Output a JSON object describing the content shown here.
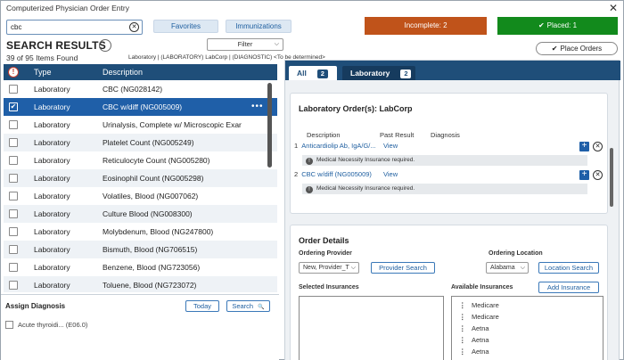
{
  "window": {
    "title": "Computerized Physician Order Entry",
    "close_glyph": "✕"
  },
  "search": {
    "value": "cbc",
    "clear_glyph": "✕"
  },
  "chips": {
    "favorites": "Favorites",
    "immunizations": "Immunizations"
  },
  "status": {
    "incomplete": "Incomplete: 2",
    "placed": "Placed: 1",
    "incomplete_color": "#c0531a",
    "placed_color": "#128a1c"
  },
  "place_orders": {
    "check": "✔",
    "label": "Place Orders"
  },
  "results": {
    "title": "SEARCH RESULTS",
    "count": "39 of 95 Items Found",
    "filter_label": "Filter",
    "breadcrumb": "Laboratory | (LABORATORY) LabCorp | (DIAGNOSTIC) <To be determined>"
  },
  "table": {
    "headers": {
      "alert": "!",
      "type": "Type",
      "description": "Description"
    },
    "rows": [
      {
        "type": "Laboratory",
        "description": "CBC (NG028142)"
      },
      {
        "type": "Laboratory",
        "description": "CBC w/diff (NG005009)",
        "selected": true,
        "check": "✔",
        "dots": "•••"
      },
      {
        "type": "Laboratory",
        "description": "Urinalysis, Complete w/ Microscopic Exar"
      },
      {
        "type": "Laboratory",
        "description": "Platelet Count (NG005249)"
      },
      {
        "type": "Laboratory",
        "description": "Reticulocyte Count (NG005280)"
      },
      {
        "type": "Laboratory",
        "description": "Eosinophil Count (NG005298)"
      },
      {
        "type": "Laboratory",
        "description": "Volatiles, Blood (NG007062)"
      },
      {
        "type": "Laboratory",
        "description": "Culture Blood (NG008300)"
      },
      {
        "type": "Laboratory",
        "description": "Molybdenum, Blood (NG247800)"
      },
      {
        "type": "Laboratory",
        "description": "Bismuth, Blood (NG706515)"
      },
      {
        "type": "Laboratory",
        "description": "Benzene, Blood (NG723056)"
      },
      {
        "type": "Laboratory",
        "description": "Toluene, Blood (NG723072)"
      }
    ]
  },
  "assign": {
    "title": "Assign Diagnosis",
    "today": "Today",
    "search": "Search",
    "search_icon": "🔍",
    "diagnosis": "Acute thyroidi... (E06.0)"
  },
  "tabs": {
    "all": {
      "label": "All",
      "count": "2"
    },
    "lab": {
      "label": "Laboratory",
      "count": "2"
    }
  },
  "lab_orders": {
    "title": "Laboratory Order(s): LabCorp",
    "col_description": "Description",
    "col_past_result": "Past Result",
    "col_diagnosis": "Diagnosis",
    "items": [
      {
        "index": "1",
        "name": "Anticardiolip Ab, IgA/G/...",
        "view": "View",
        "notice": "Medical Necessity Insurance required.",
        "info": "!",
        "add": "+",
        "remove": "✕"
      },
      {
        "index": "2",
        "name": "CBC w/diff (NG005009)",
        "view": "View",
        "notice": "Medical Necessity Insurance required.",
        "info": "!",
        "add": "+",
        "remove": "✕"
      }
    ]
  },
  "order_details": {
    "title": "Order Details",
    "ordering_provider": "Ordering Provider",
    "provider_value": "New, Provider_T",
    "provider_search": "Provider Search",
    "ordering_location": "Ordering Location",
    "location_value": "Alabama",
    "location_search": "Location Search",
    "selected_insurances": "Selected Insurances",
    "available_insurances": "Available Insurances",
    "add_insurance": "Add Insurance",
    "grip": "⋮",
    "chevron": "⌵",
    "insurances": [
      "Medicare",
      "Medicare",
      "Aetna",
      "Aetna",
      "Aetna"
    ]
  }
}
